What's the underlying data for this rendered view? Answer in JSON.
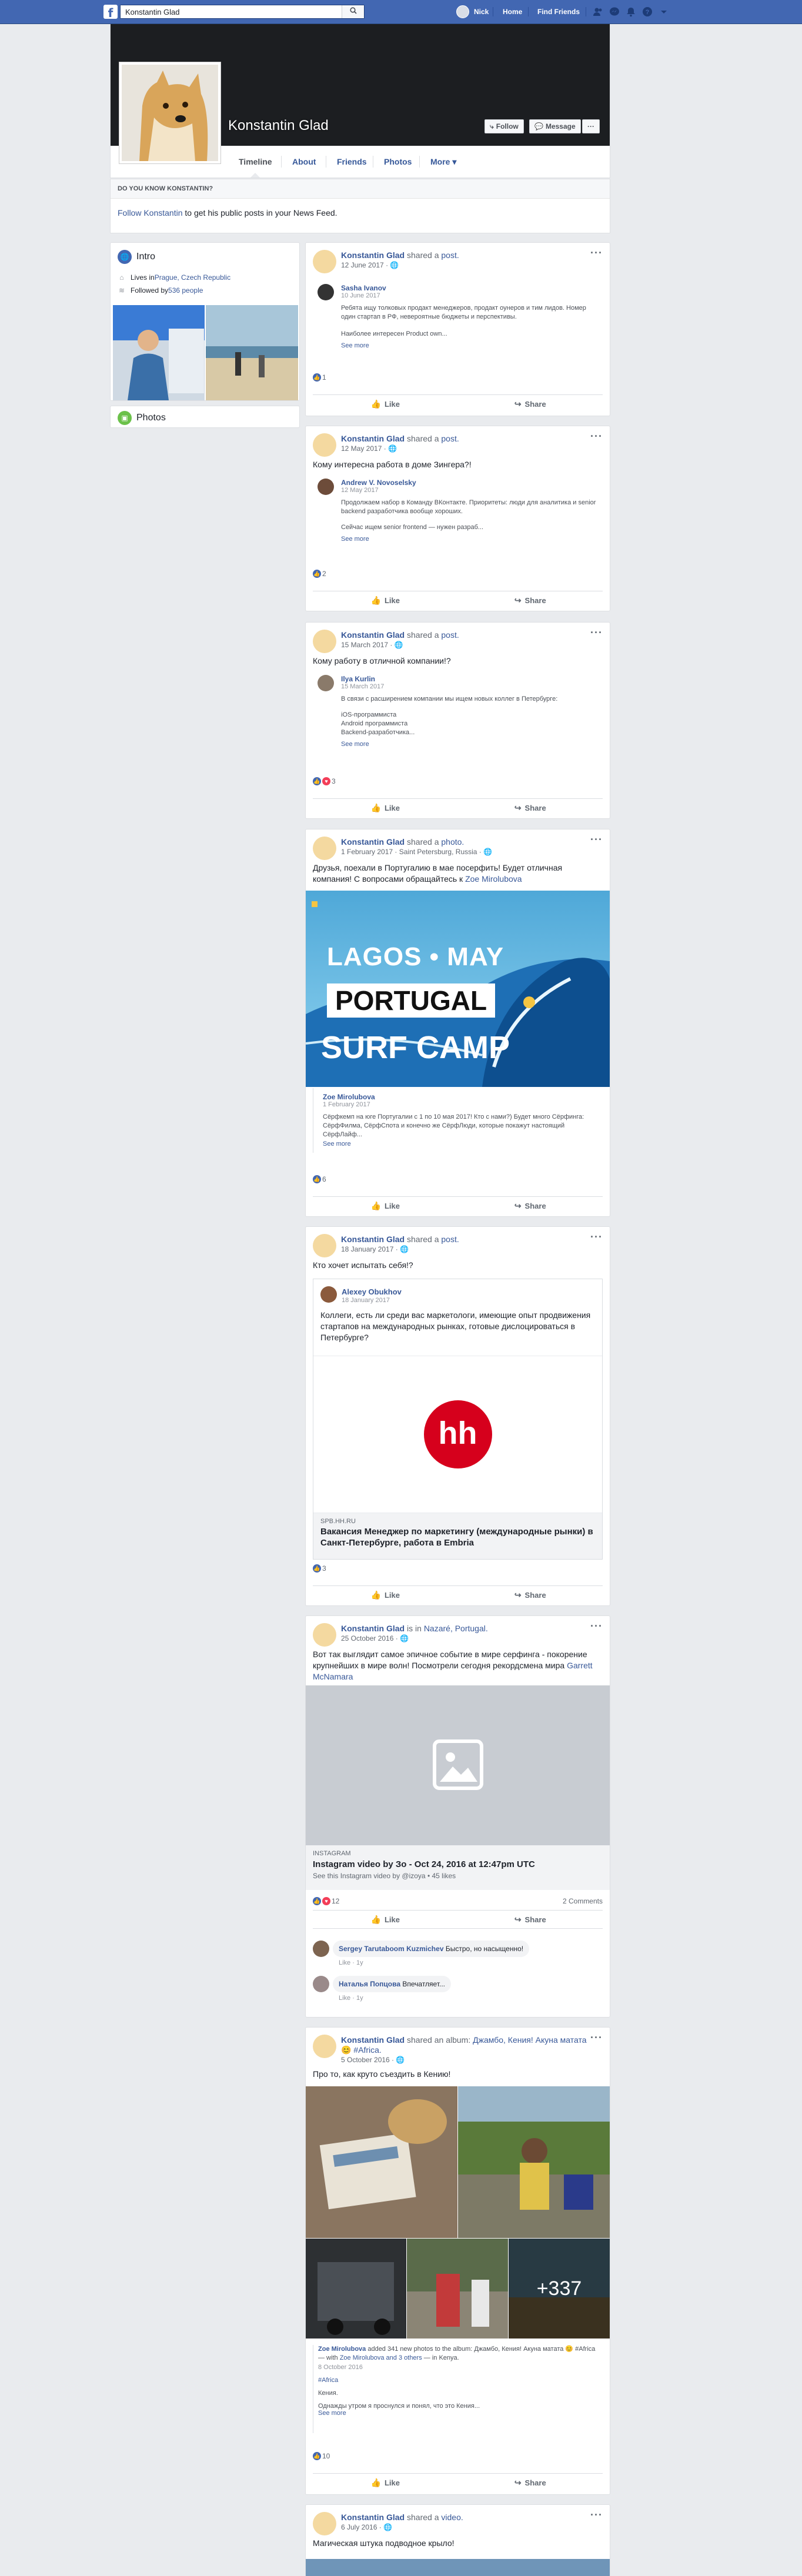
{
  "topbar": {
    "logo": "f",
    "search_value": "Konstantin Glad",
    "search_placeholder": "Search",
    "user_name": "Nick",
    "nav_home": "Home",
    "nav_find_friends": "Find Friends"
  },
  "profile": {
    "name": "Konstantin Glad",
    "follow_label": "Follow",
    "message_label": "Message",
    "more_label": "···",
    "tabs": [
      "Timeline",
      "About",
      "Friends",
      "Photos",
      "More ▾"
    ]
  },
  "know": {
    "title": "Do you know Konstantin?",
    "link": "Follow Konstantin",
    "rest": " to get his public posts in your News Feed."
  },
  "intro": {
    "title": "Intro",
    "lives_prefix": "Lives in ",
    "lives_city": "Prague, Czech Republic",
    "followed_prefix": "Followed by ",
    "followed_count": "536 people"
  },
  "photos_title": "Photos",
  "actions": {
    "like": "Like",
    "share": "Share"
  },
  "posts": [
    {
      "author": "Konstantin Glad",
      "verb": "shared a ",
      "object": "post.",
      "date": "12 June 2017 · ",
      "shared_name": "Sasha Ivanov",
      "shared_date": "10 June 2017",
      "shared_text": "Ребята ищу толковых продакт менеджеров, продакт оунеров и тим лидов. Номер один стартап в РФ, невероятные бюджеты и перспективы.",
      "shared_text2": "Наиболее интересен Product own...",
      "see_more": "See more",
      "likes": "1"
    },
    {
      "author": "Konstantin Glad",
      "verb": "shared a ",
      "object": "post.",
      "date": "12 May 2017 · ",
      "text": "Кому интересна работа в доме Зингера?!",
      "shared_name": "Andrew V. Novoselsky",
      "shared_date": "12 May 2017",
      "shared_text": "Продолжаем набор в Команду ВКонтакте. Приоритеты: люди для аналитика и senior backend разработчика вообще хороших.",
      "shared_text2": "Сейчас ищем senior frontend — нужен разраб...",
      "see_more": "See more",
      "likes": "2"
    },
    {
      "author": "Konstantin Glad",
      "verb": "shared a ",
      "object": "post.",
      "date": "15 March 2017 · ",
      "text": "Кому работу в отличной компании!?",
      "shared_name": "Ilya Kurlin",
      "shared_date": "15 March 2017",
      "shared_text": "В связи с расширением компании мы ищем новых коллег в Петербурге:",
      "shared_list": [
        "iOS-программиста",
        "Android программиста",
        "Backend-разработчика..."
      ],
      "see_more": "See more",
      "likes": "3"
    },
    {
      "author": "Konstantin Glad",
      "verb": "shared a ",
      "object": "photo.",
      "date": "1 February 2017 · Saint Petersburg, Russia · ",
      "text": "Друзья, поехали в Португалию в мае посерфить! Будет отличная компания! С вопросами обращайтесь к ",
      "text_link": "Zoe Mirolubova",
      "banner_line1": "LAGOS • MAY",
      "banner_line2": "PORTUGAL",
      "banner_line3": "SURF CAMP",
      "shared_name": "Zoe Mirolubova",
      "shared_date": "1 February 2017",
      "shared_text": "Сёрфкемп на юге Португалии с 1 по 10 мая 2017! Кто с нами?) Будет много Сёрфинга: СёрфФилма, СёрфСпота и конечно же СёрфЛюди, которые покажут настоящий СёрфЛайф...",
      "see_more": "See more",
      "likes": "6"
    },
    {
      "author": "Konstantin Glad",
      "verb": "shared a ",
      "object": "post.",
      "date": "18 January 2017 · ",
      "text": "Кто хочет испытать себя!?",
      "shared_name": "Alexey Obukhov",
      "shared_date": "18 January 2017",
      "shared_text": "Коллеги, есть ли среди вас маркетологи, имеющие опыт продвижения стартапов на международных рынках, готовые дислоцироваться в Петербурге?",
      "hh_logo": "hh",
      "card_domain": "SPB.HH.RU",
      "card_title": "Вакансия Менеджер по маркетингу (международные рынки) в Санкт-Петербурге, работа в Embria",
      "likes": "3"
    },
    {
      "author": "Konstantin Glad",
      "verb": "is in ",
      "object": "Nazaré, Portugal.",
      "date": "25 October 2016 · ",
      "text": "Вот так выглядит самое эпичное событие в мире серфинга - покорение крупнейших в мире волн! Посмотрели сегодня рекордсмена мира ",
      "text_link": "Garrett McNamara",
      "card_domain": "INSTAGRAM",
      "card_title": "Instagram video by Зо - Oct 24, 2016 at 12:47pm UTC",
      "card_sub": "See this Instagram video by @izoya • 45 likes",
      "likes": "12",
      "comments": "2 Comments",
      "c1_name": "Sergey Tarutaboom Kuzmichev",
      "c1_text": "Быстро, но насыщенно!",
      "c1_meta": "Like · 1y",
      "c2_name": "Наталья Попцова",
      "c2_text": "Впечатляет...",
      "c2_meta": "Like · 1y"
    },
    {
      "author": "Konstantin Glad",
      "verb": "shared an ",
      "object_prefix": "album: ",
      "object": "Джамбо, Кения! Акуна матата 😊 #Africa.",
      "date": "5 October 2016 · ",
      "text": "Про то, как круто съездить в Кению!",
      "more_photos": "+337",
      "shared_name": "Zoe Mirolubova",
      "shared_header": " added 341 new photos to the album: Джамбо, Кения! Акуна матата 😊 #Africa — with ",
      "shared_with": "Zoe Mirolubova and 3 others",
      "shared_place": " — in Kenya.",
      "shared_date": "8 October 2016",
      "shared_tag": "#Africa",
      "shared_text": "Кения.",
      "shared_text2": "Однажды утром я проснулся и понял, что это Кения...",
      "see_more": "See more",
      "likes": "10"
    },
    {
      "author": "Konstantin Glad",
      "verb": "shared a ",
      "object": "video.",
      "date": "6 July 2016 · ",
      "text": "Магическая штука подводное крыло!"
    }
  ]
}
